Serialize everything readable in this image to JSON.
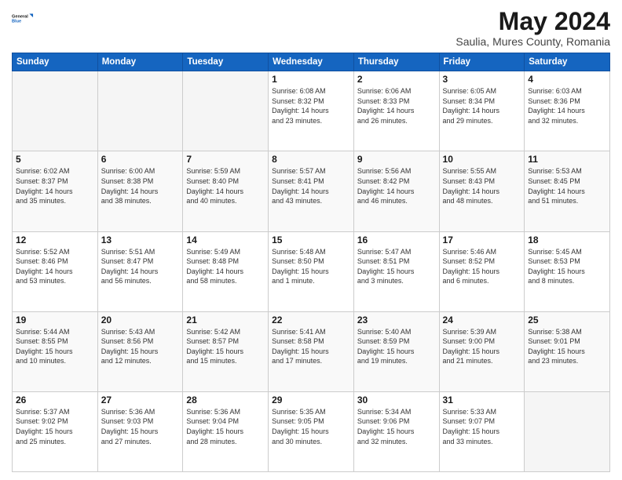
{
  "header": {
    "logo_line1": "General",
    "logo_line2": "Blue",
    "main_title": "May 2024",
    "subtitle": "Saulia, Mures County, Romania"
  },
  "days_of_week": [
    "Sunday",
    "Monday",
    "Tuesday",
    "Wednesday",
    "Thursday",
    "Friday",
    "Saturday"
  ],
  "weeks": [
    [
      {
        "day": "",
        "info": ""
      },
      {
        "day": "",
        "info": ""
      },
      {
        "day": "",
        "info": ""
      },
      {
        "day": "1",
        "info": "Sunrise: 6:08 AM\nSunset: 8:32 PM\nDaylight: 14 hours\nand 23 minutes."
      },
      {
        "day": "2",
        "info": "Sunrise: 6:06 AM\nSunset: 8:33 PM\nDaylight: 14 hours\nand 26 minutes."
      },
      {
        "day": "3",
        "info": "Sunrise: 6:05 AM\nSunset: 8:34 PM\nDaylight: 14 hours\nand 29 minutes."
      },
      {
        "day": "4",
        "info": "Sunrise: 6:03 AM\nSunset: 8:36 PM\nDaylight: 14 hours\nand 32 minutes."
      }
    ],
    [
      {
        "day": "5",
        "info": "Sunrise: 6:02 AM\nSunset: 8:37 PM\nDaylight: 14 hours\nand 35 minutes."
      },
      {
        "day": "6",
        "info": "Sunrise: 6:00 AM\nSunset: 8:38 PM\nDaylight: 14 hours\nand 38 minutes."
      },
      {
        "day": "7",
        "info": "Sunrise: 5:59 AM\nSunset: 8:40 PM\nDaylight: 14 hours\nand 40 minutes."
      },
      {
        "day": "8",
        "info": "Sunrise: 5:57 AM\nSunset: 8:41 PM\nDaylight: 14 hours\nand 43 minutes."
      },
      {
        "day": "9",
        "info": "Sunrise: 5:56 AM\nSunset: 8:42 PM\nDaylight: 14 hours\nand 46 minutes."
      },
      {
        "day": "10",
        "info": "Sunrise: 5:55 AM\nSunset: 8:43 PM\nDaylight: 14 hours\nand 48 minutes."
      },
      {
        "day": "11",
        "info": "Sunrise: 5:53 AM\nSunset: 8:45 PM\nDaylight: 14 hours\nand 51 minutes."
      }
    ],
    [
      {
        "day": "12",
        "info": "Sunrise: 5:52 AM\nSunset: 8:46 PM\nDaylight: 14 hours\nand 53 minutes."
      },
      {
        "day": "13",
        "info": "Sunrise: 5:51 AM\nSunset: 8:47 PM\nDaylight: 14 hours\nand 56 minutes."
      },
      {
        "day": "14",
        "info": "Sunrise: 5:49 AM\nSunset: 8:48 PM\nDaylight: 14 hours\nand 58 minutes."
      },
      {
        "day": "15",
        "info": "Sunrise: 5:48 AM\nSunset: 8:50 PM\nDaylight: 15 hours\nand 1 minute."
      },
      {
        "day": "16",
        "info": "Sunrise: 5:47 AM\nSunset: 8:51 PM\nDaylight: 15 hours\nand 3 minutes."
      },
      {
        "day": "17",
        "info": "Sunrise: 5:46 AM\nSunset: 8:52 PM\nDaylight: 15 hours\nand 6 minutes."
      },
      {
        "day": "18",
        "info": "Sunrise: 5:45 AM\nSunset: 8:53 PM\nDaylight: 15 hours\nand 8 minutes."
      }
    ],
    [
      {
        "day": "19",
        "info": "Sunrise: 5:44 AM\nSunset: 8:55 PM\nDaylight: 15 hours\nand 10 minutes."
      },
      {
        "day": "20",
        "info": "Sunrise: 5:43 AM\nSunset: 8:56 PM\nDaylight: 15 hours\nand 12 minutes."
      },
      {
        "day": "21",
        "info": "Sunrise: 5:42 AM\nSunset: 8:57 PM\nDaylight: 15 hours\nand 15 minutes."
      },
      {
        "day": "22",
        "info": "Sunrise: 5:41 AM\nSunset: 8:58 PM\nDaylight: 15 hours\nand 17 minutes."
      },
      {
        "day": "23",
        "info": "Sunrise: 5:40 AM\nSunset: 8:59 PM\nDaylight: 15 hours\nand 19 minutes."
      },
      {
        "day": "24",
        "info": "Sunrise: 5:39 AM\nSunset: 9:00 PM\nDaylight: 15 hours\nand 21 minutes."
      },
      {
        "day": "25",
        "info": "Sunrise: 5:38 AM\nSunset: 9:01 PM\nDaylight: 15 hours\nand 23 minutes."
      }
    ],
    [
      {
        "day": "26",
        "info": "Sunrise: 5:37 AM\nSunset: 9:02 PM\nDaylight: 15 hours\nand 25 minutes."
      },
      {
        "day": "27",
        "info": "Sunrise: 5:36 AM\nSunset: 9:03 PM\nDaylight: 15 hours\nand 27 minutes."
      },
      {
        "day": "28",
        "info": "Sunrise: 5:36 AM\nSunset: 9:04 PM\nDaylight: 15 hours\nand 28 minutes."
      },
      {
        "day": "29",
        "info": "Sunrise: 5:35 AM\nSunset: 9:05 PM\nDaylight: 15 hours\nand 30 minutes."
      },
      {
        "day": "30",
        "info": "Sunrise: 5:34 AM\nSunset: 9:06 PM\nDaylight: 15 hours\nand 32 minutes."
      },
      {
        "day": "31",
        "info": "Sunrise: 5:33 AM\nSunset: 9:07 PM\nDaylight: 15 hours\nand 33 minutes."
      },
      {
        "day": "",
        "info": ""
      }
    ]
  ]
}
